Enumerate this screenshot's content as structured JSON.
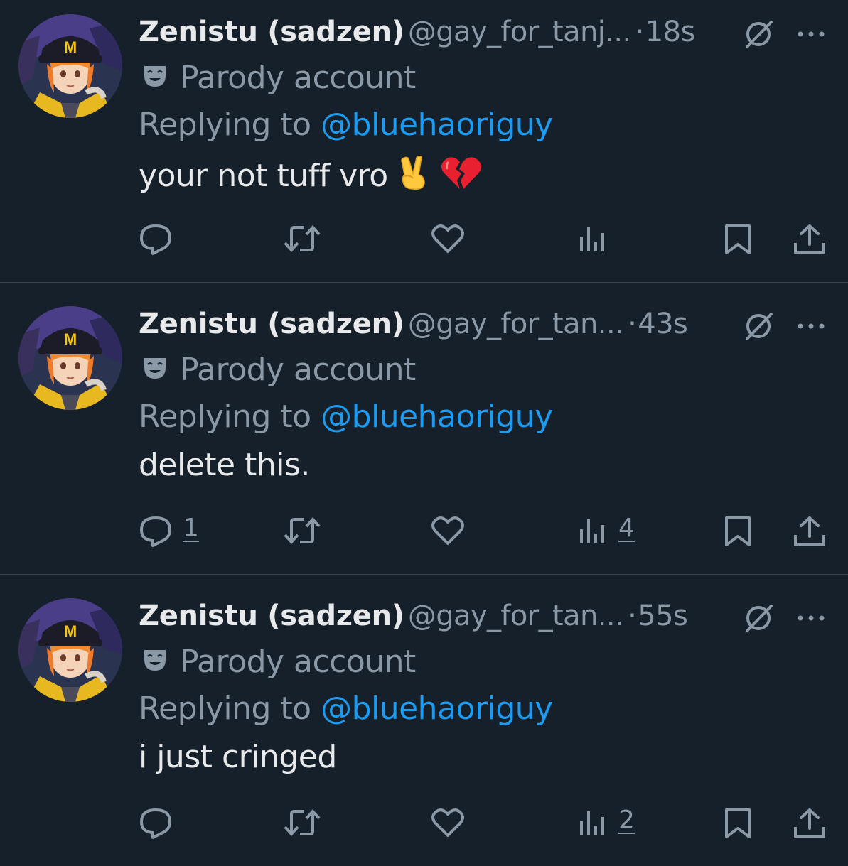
{
  "tweets": [
    {
      "display_name": "Zenistu (sadzen)",
      "handle": "@gay_for_tanj...",
      "separator": "·",
      "time": "18s",
      "parody_label": "Parody account",
      "replying_to_label": "Replying to",
      "reply_handle": "@bluehaoriguy",
      "text": "your not tuff vro",
      "emojis": [
        "victory-hand-emoji",
        "broken-heart-emoji"
      ],
      "reply_count": "",
      "views_count": ""
    },
    {
      "display_name": "Zenistu (sadzen)",
      "handle": "@gay_for_tan...",
      "separator": "·",
      "time": "43s",
      "parody_label": "Parody account",
      "replying_to_label": "Replying to",
      "reply_handle": "@bluehaoriguy",
      "text": "delete this.",
      "emojis": [],
      "reply_count": "1",
      "views_count": "4"
    },
    {
      "display_name": "Zenistu (sadzen)",
      "handle": "@gay_for_tan...",
      "separator": "·",
      "time": "55s",
      "parody_label": "Parody account",
      "replying_to_label": "Replying to",
      "reply_handle": "@bluehaoriguy",
      "text": "i just cringed",
      "emojis": [],
      "reply_count": "",
      "views_count": "2"
    }
  ],
  "icons": {
    "header": [
      "mute-icon",
      "more-icon",
      "parody-mask-icon"
    ],
    "actions": [
      "reply-icon",
      "retweet-icon",
      "like-icon",
      "views-icon",
      "bookmark-icon",
      "share-icon"
    ]
  },
  "colors": {
    "background": "#15202b",
    "text": "#e7e9ea",
    "secondary": "#8b98a5",
    "link": "#1d9bf0",
    "divider": "#38444d"
  }
}
